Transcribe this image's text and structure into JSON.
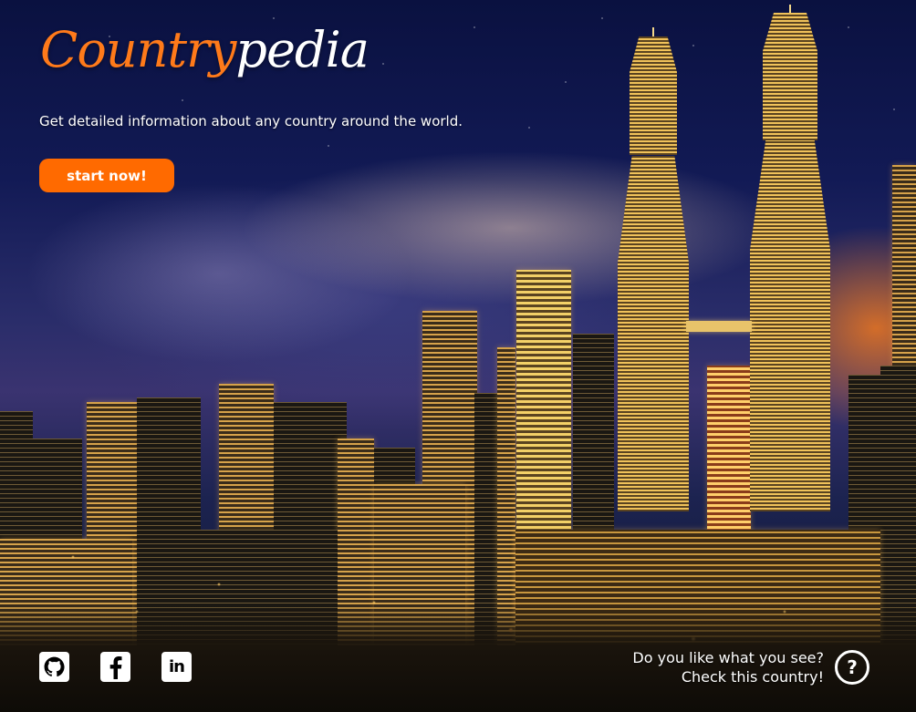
{
  "brand": {
    "logo_part1": "Country",
    "logo_part2": "pedia",
    "accent_color": "#ff6a00"
  },
  "hero": {
    "tagline": "Get detailed information about any country around the world.",
    "start_label": "start now!"
  },
  "social": [
    {
      "name": "github",
      "icon": "github-icon"
    },
    {
      "name": "facebook",
      "icon": "facebook-icon"
    },
    {
      "name": "linkedin",
      "icon": "linkedin-icon",
      "glyph": "in"
    }
  ],
  "cta": {
    "line1": "Do you like what you see?",
    "line2": "Check this country!",
    "help_glyph": "?"
  }
}
